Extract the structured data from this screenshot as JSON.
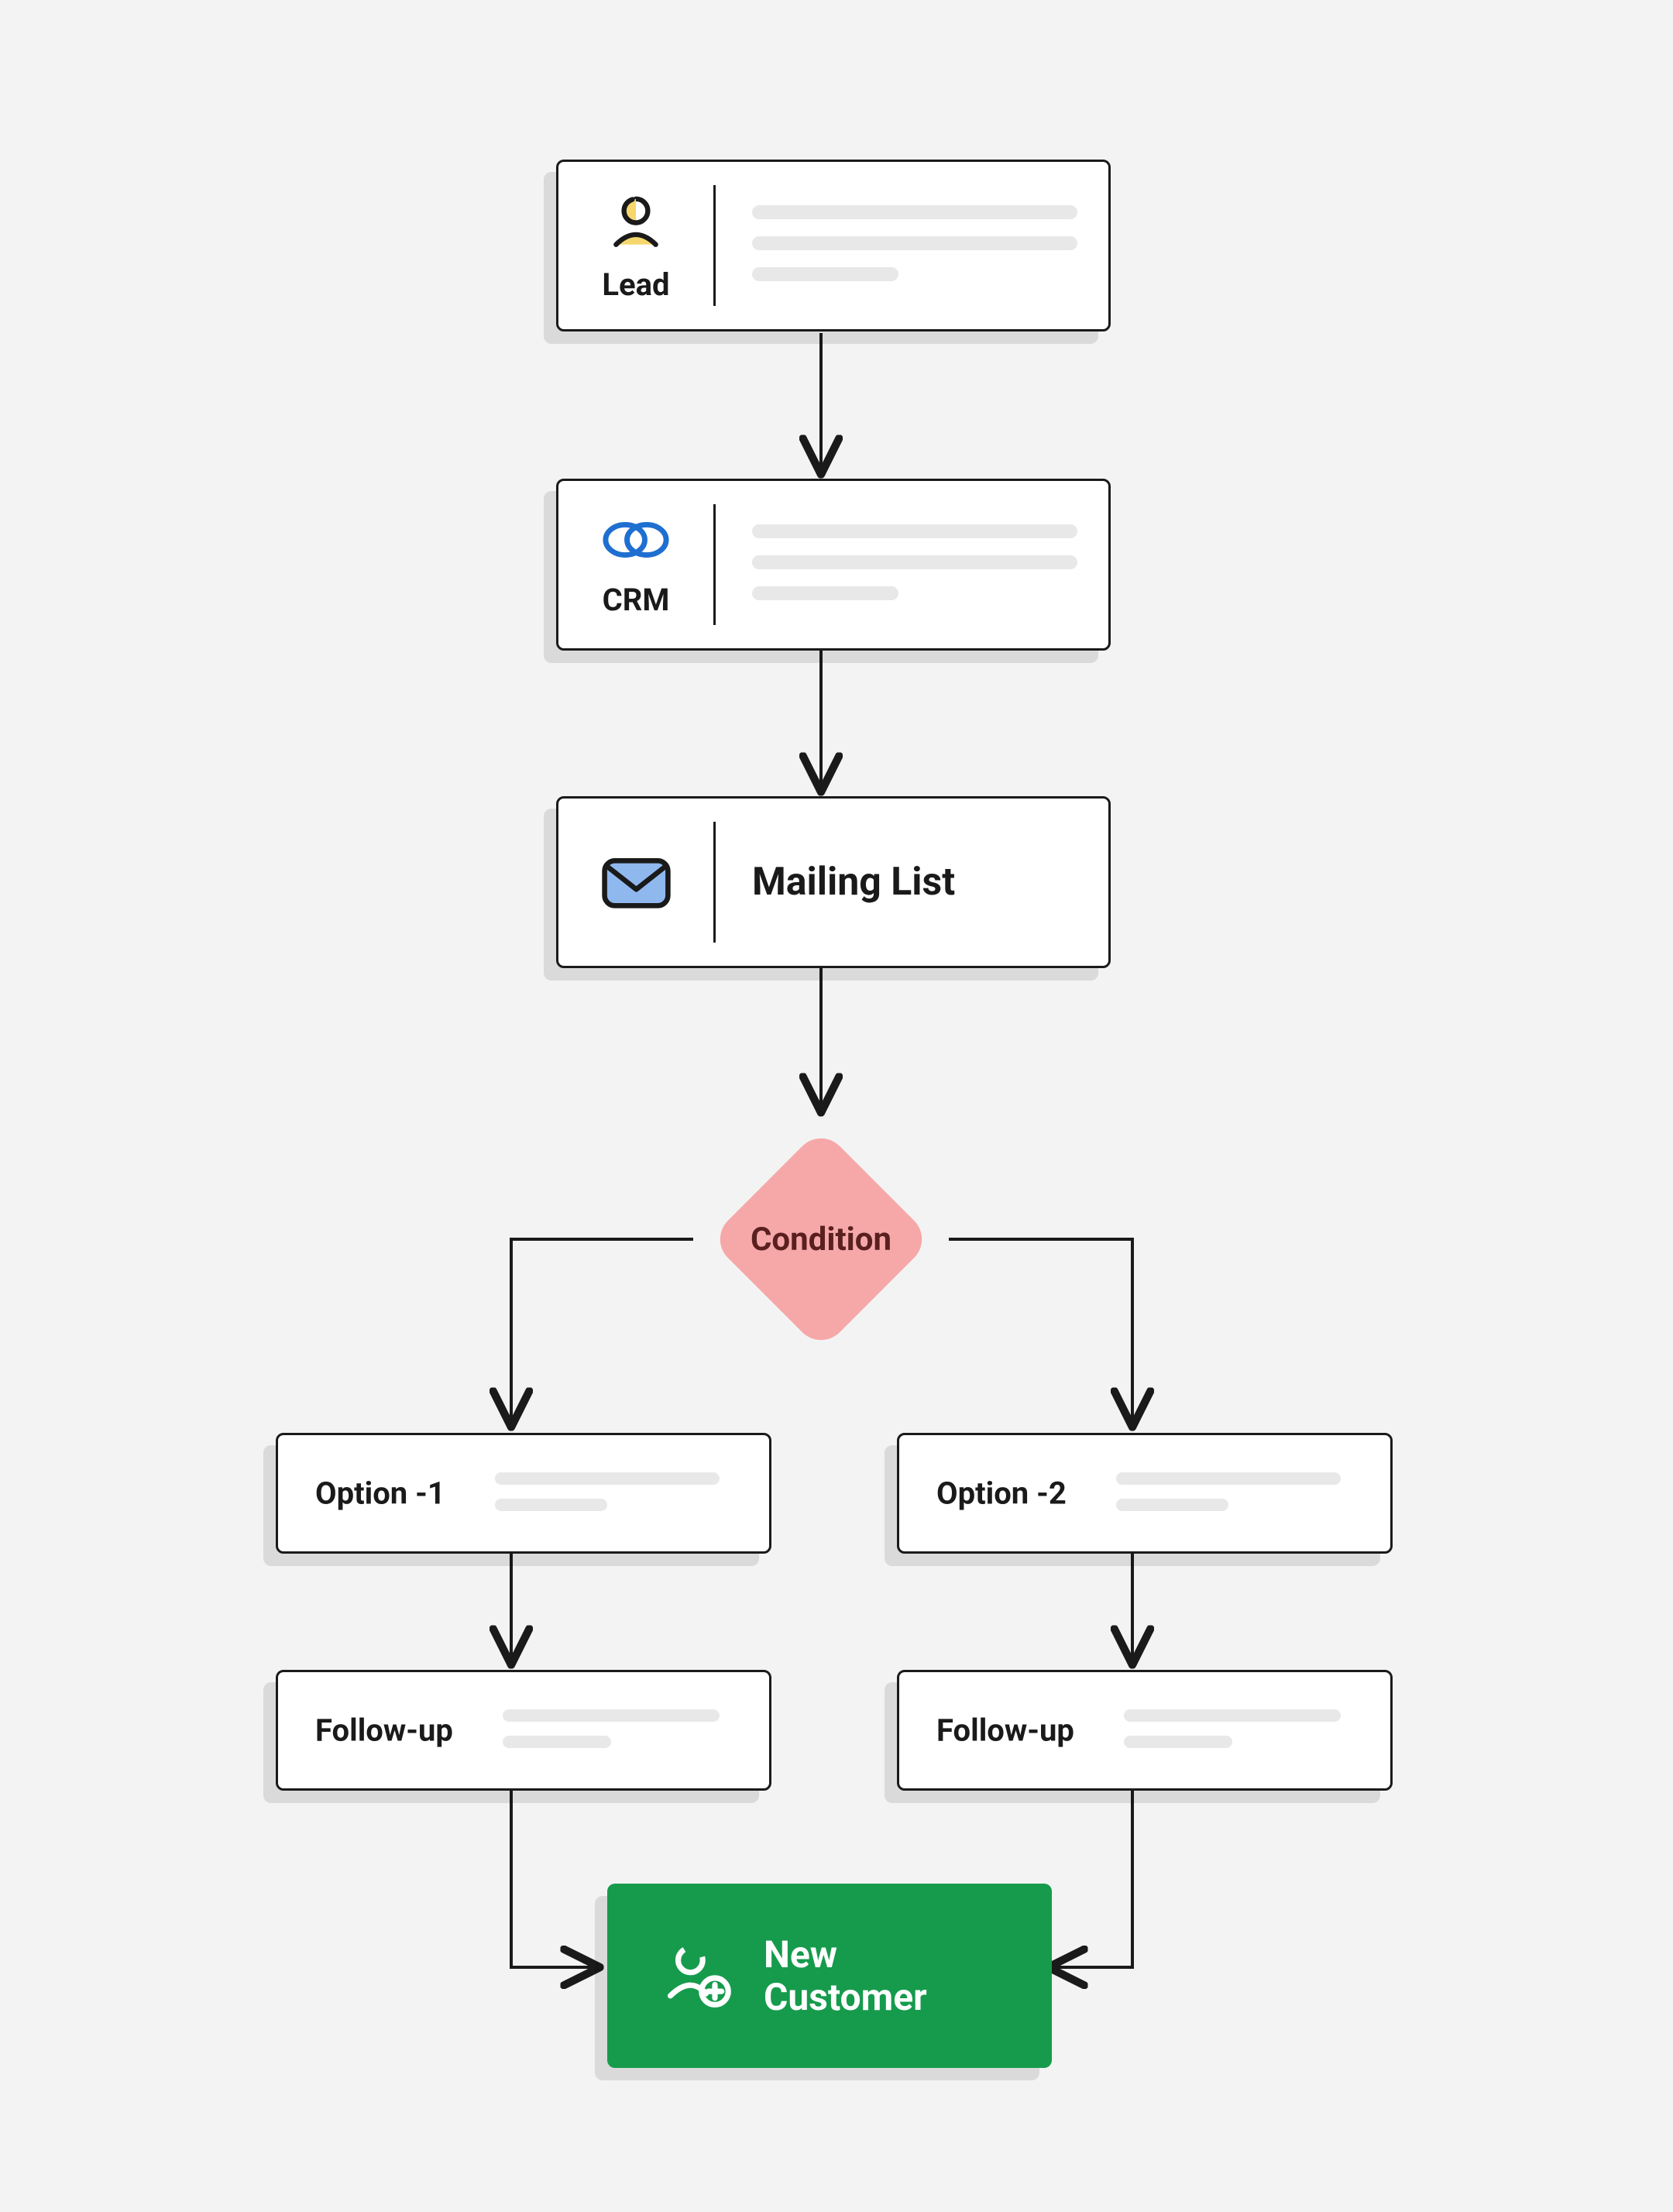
{
  "nodes": {
    "lead": {
      "label": "Lead"
    },
    "crm": {
      "label": "CRM"
    },
    "mailing_list": {
      "label": "Mailing List"
    },
    "condition": {
      "label": "Condition"
    },
    "option_left": {
      "label": "Option -1"
    },
    "option_right": {
      "label": "Option -2"
    },
    "followup_left": {
      "label": "Follow-up"
    },
    "followup_right": {
      "label": "Follow-up"
    },
    "new_customer": {
      "line1": "New",
      "line2": "Customer"
    }
  },
  "icons": {
    "lead": "person-icon",
    "crm": "link-chain-icon",
    "mail": "mail-icon",
    "customer": "person-plus-icon"
  },
  "colors": {
    "condition_fill": "#f6a8a8",
    "condition_text": "#5a1f1f",
    "green": "#169b4c",
    "line": "#1a1a1a",
    "skeleton": "#e8e8e8",
    "crm_blue": "#1f6fd1",
    "mail_blue": "#8fb8ef",
    "lead_yellow": "#f5d76e"
  }
}
